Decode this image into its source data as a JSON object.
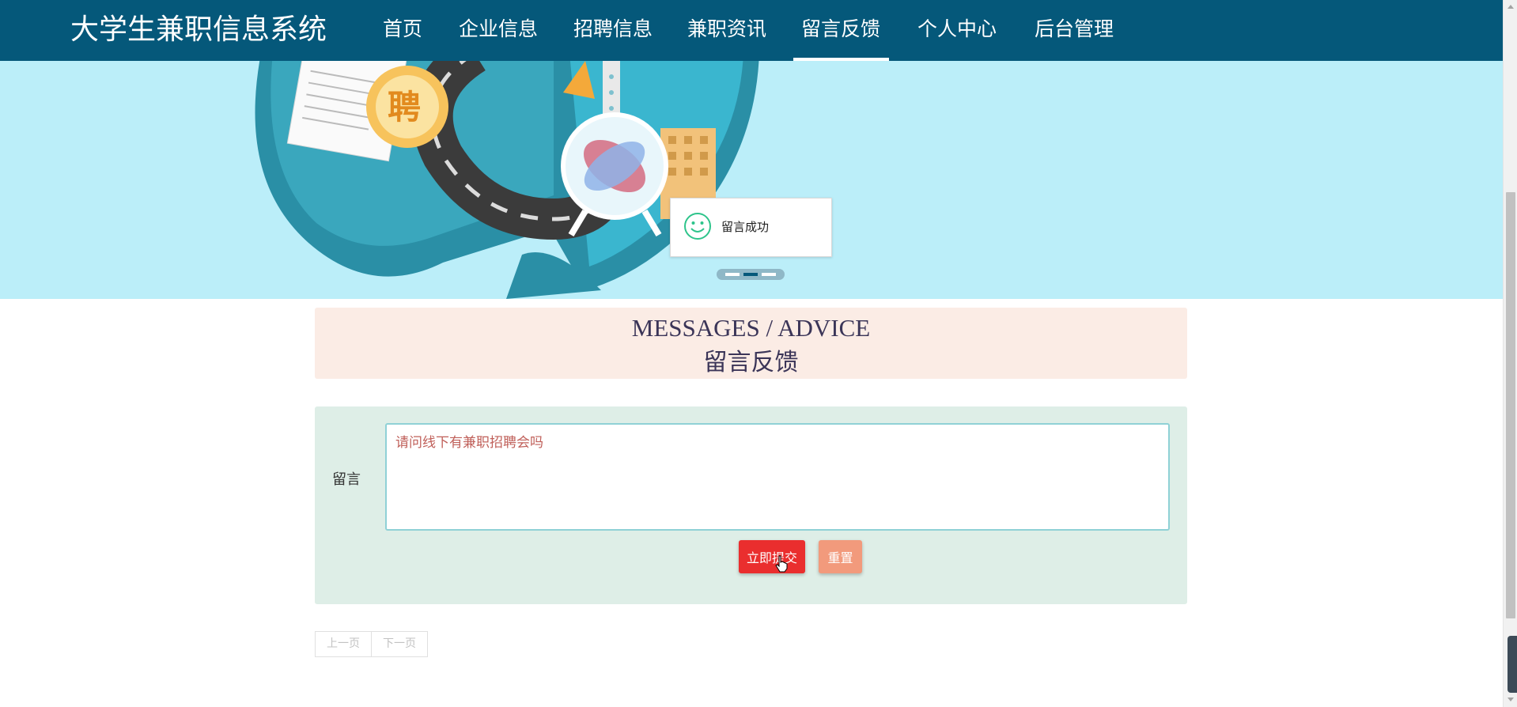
{
  "app": {
    "brand": "大学生兼职信息系统"
  },
  "nav": {
    "items": [
      {
        "label": "首页",
        "active": false
      },
      {
        "label": "企业信息",
        "active": false
      },
      {
        "label": "招聘信息",
        "active": false
      },
      {
        "label": "兼职资讯",
        "active": false
      },
      {
        "label": "留言反馈",
        "active": true
      },
      {
        "label": "个人中心",
        "active": false
      },
      {
        "label": "后台管理",
        "active": false
      }
    ]
  },
  "banner": {
    "badge_text": "聘",
    "carousel": {
      "count": 3,
      "active_index": 1
    }
  },
  "toast": {
    "message": "留言成功",
    "icon": "smile-icon"
  },
  "section": {
    "title_en": "MESSAGES / ADVICE",
    "title_cn": "留言反馈"
  },
  "form": {
    "label": "留言",
    "textarea_value": "请问线下有兼职招聘会吗",
    "submit_label": "立即提交",
    "reset_label": "重置"
  },
  "pager": {
    "prev_label": "上一页",
    "next_label": "下一页"
  },
  "colors": {
    "nav_bg": "#05587a",
    "banner_bg": "#bbeef9",
    "header_bg": "#fbece5",
    "form_bg": "#deeee7",
    "submit": "#ea2e2e",
    "reset": "#f29a7c"
  }
}
